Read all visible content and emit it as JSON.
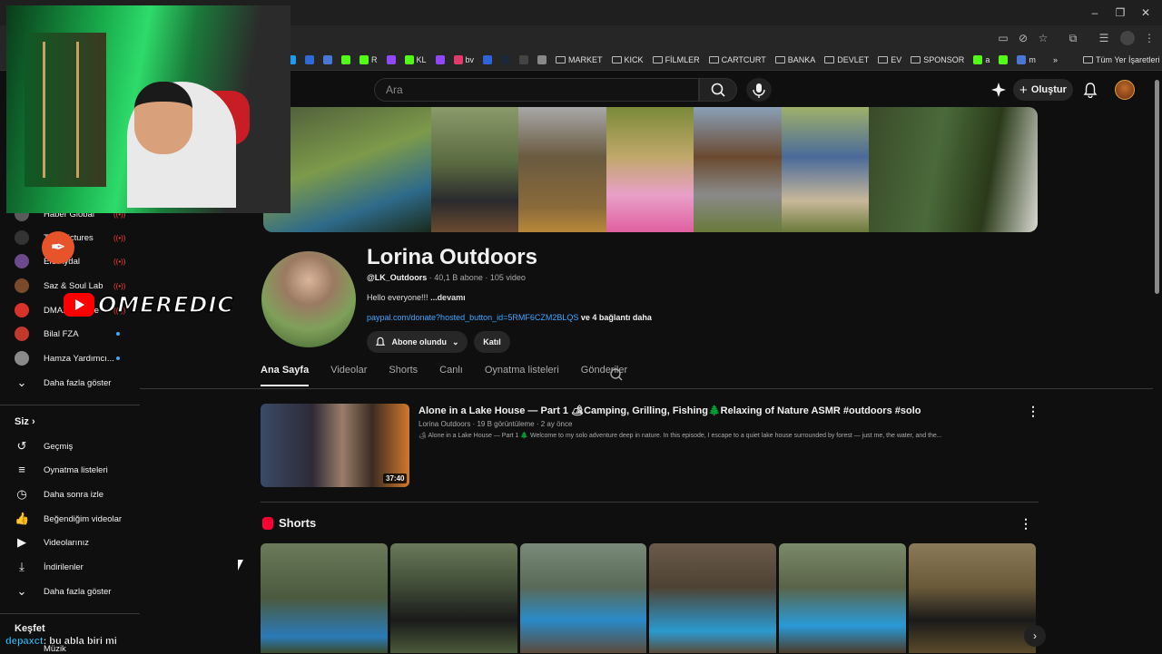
{
  "colors": {
    "bg": "#0f0f0f",
    "accent_link": "#3ea6ff",
    "yt_red": "#ff0000",
    "live_red": "#ff3b3b"
  },
  "browser": {
    "window_controls": [
      "–",
      "❐",
      "✕"
    ],
    "toolbar_icons": [
      "cast-icon",
      "eye-off-icon",
      "star-icon",
      "extensions-icon",
      "reading-list-icon",
      "profile-icon",
      "menu-icon"
    ],
    "bookmarks": [
      {
        "label": "",
        "icon": "twitter-icon",
        "color": "#1d9bf0"
      },
      {
        "label": "",
        "icon": "ms-icon",
        "color": "#2e6bd8"
      },
      {
        "label": "",
        "icon": "m-icon",
        "color": "#4a76d4"
      },
      {
        "label": "",
        "icon": "kick-icon",
        "color": "#53fc18"
      },
      {
        "label": "R",
        "icon": "kick-icon",
        "color": "#53fc18"
      },
      {
        "label": "",
        "icon": "twitch-icon",
        "color": "#9146ff"
      },
      {
        "label": "KL",
        "icon": "kick-icon",
        "color": "#53fc18"
      },
      {
        "label": "",
        "icon": "twitch-icon",
        "color": "#9146ff"
      },
      {
        "label": "bv",
        "icon": "bv-icon",
        "color": "#e03b6b"
      },
      {
        "label": "",
        "icon": "r-icon",
        "color": "#2f64d8"
      },
      {
        "label": "",
        "icon": "steam-icon",
        "color": "#1b2838"
      },
      {
        "label": "",
        "icon": "tcd-icon",
        "color": "#444444"
      },
      {
        "label": "",
        "icon": "globe-icon",
        "color": "#888888"
      }
    ],
    "bookmark_folders": [
      "MARKET",
      "KICK",
      "FİLMLER",
      "CARTCURT",
      "BANKA",
      "DEVLET",
      "EV",
      "SPONSOR"
    ],
    "bookmark_tail": [
      {
        "label": "a",
        "color": "#53fc18"
      },
      {
        "label": "",
        "color": "#53fc18"
      },
      {
        "label": "m",
        "color": "#4a76d4"
      }
    ],
    "bookmarks_more": "»",
    "all_bookmarks": "Tüm Yer İşaretleri"
  },
  "header": {
    "search_placeholder": "Ara",
    "create_label": "Oluştur"
  },
  "channel": {
    "name": "Lorina Outdoors",
    "handle": "@LK_Outdoors",
    "meta": " · 40,1 B abone · 105 video",
    "description": "Hello everyone!!!",
    "description_more": "...devamı",
    "link": "paypal.com/donate?hosted_button_id=5RMF6CZM2BLQS",
    "link_more": "ve 4 bağlantı daha",
    "subscribe_label": "Abone olundu",
    "join_label": "Katıl",
    "tabs": [
      "Ana Sayfa",
      "Videolar",
      "Shorts",
      "Canlı",
      "Oynatma listeleri",
      "Gönderiler"
    ]
  },
  "featured": {
    "title": "Alone in a Lake House — Part 1 🏕Camping, Grilling, Fishing🌲Relaxing of Nature ASMR #outdoors #solo",
    "meta": "Lorina Outdoors · 19 B görüntüleme · 2 ay önce",
    "description": "🏕 Alone in a Lake House — Part 1 🌲 Welcome to my solo adventure deep in nature. In this episode, I escape to a quiet lake house surrounded by forest — just me, the water, and the...",
    "duration": "37:40"
  },
  "shorts": {
    "title": "Shorts",
    "thumb_colors": [
      "#4b5a3e",
      "#3e4a36",
      "#5a6a58",
      "#4e4234",
      "#5a6448",
      "#6a5a3a"
    ],
    "next_icon": "›"
  },
  "sidebar": {
    "subscriptions": [
      {
        "label": "Haber Global",
        "avatar": "#5a5a5a",
        "live": true
      },
      {
        "label": "TBT Pictures",
        "avatar": "#333333",
        "live": true
      },
      {
        "label": "Efe Aydal",
        "avatar": "#6a4a8a",
        "live": true
      },
      {
        "label": "Saz & Soul Lab",
        "avatar": "#7a4a2a",
        "live": true
      },
      {
        "label": "DMAX Türkiye",
        "avatar": "#d8322a",
        "live": true
      },
      {
        "label": "Bilal FZA",
        "avatar": "#c0392b",
        "live": false
      },
      {
        "label": "Hamza Yardımcı...",
        "avatar": "#8a8a8a",
        "live": false
      }
    ],
    "show_more": "Daha fazla göster",
    "you_heading": "Siz",
    "you_items": [
      {
        "label": "Geçmiş",
        "icon": "history-icon",
        "glyph": "↺"
      },
      {
        "label": "Oynatma listeleri",
        "icon": "playlists-icon",
        "glyph": "≡"
      },
      {
        "label": "Daha sonra izle",
        "icon": "watch-later-icon",
        "glyph": "◷"
      },
      {
        "label": "Beğendiğim videolar",
        "icon": "like-icon",
        "glyph": "👍"
      },
      {
        "label": "Videolarınız",
        "icon": "your-videos-icon",
        "glyph": "▶"
      },
      {
        "label": "İndirilenler",
        "icon": "download-icon",
        "glyph": "⤓"
      }
    ],
    "show_more_2": "Daha fazla göster",
    "explore_heading": "Keşfet",
    "explore_item": "Müzik"
  },
  "overlays": {
    "streamer_logo": "OMEREDIC",
    "chat_user": "depaxct",
    "chat_message": ": bu abla biri mi"
  }
}
